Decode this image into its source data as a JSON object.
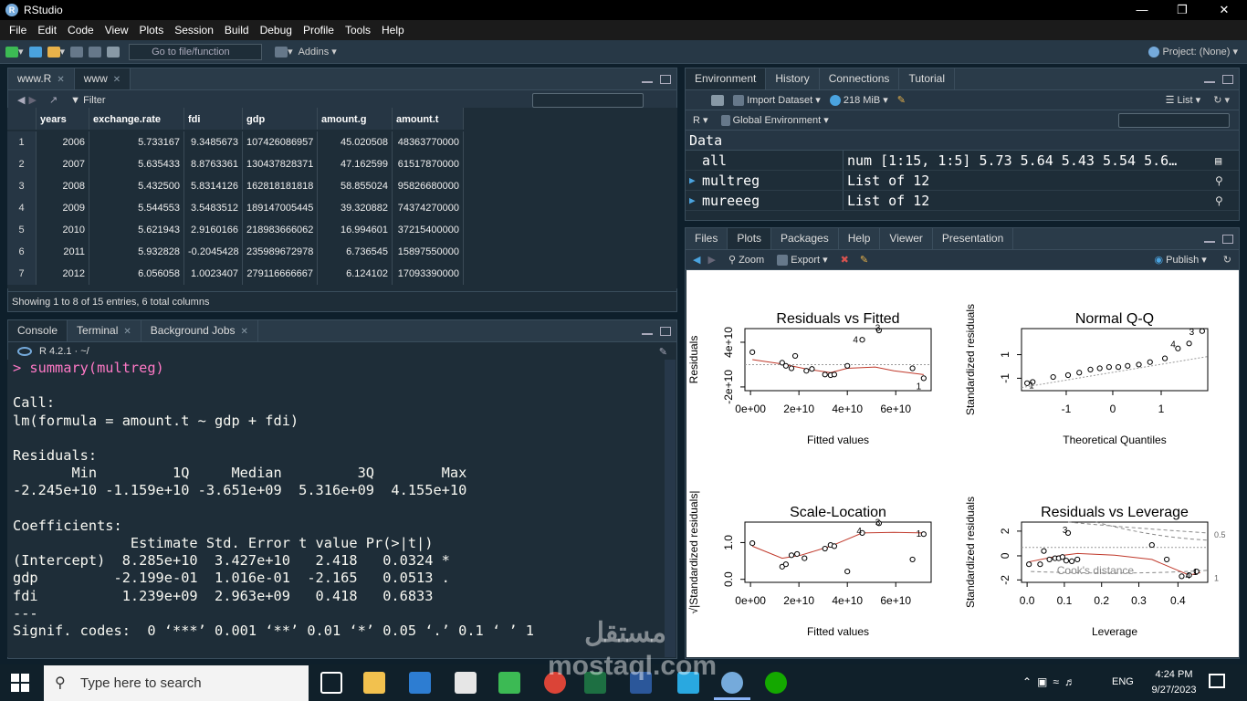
{
  "app": {
    "title": "RStudio",
    "logo_letter": "R"
  },
  "menu": [
    "File",
    "Edit",
    "Code",
    "View",
    "Plots",
    "Session",
    "Build",
    "Debug",
    "Profile",
    "Tools",
    "Help"
  ],
  "toolbar": {
    "goto_placeholder": "Go to file/function",
    "addins": "Addins",
    "project": "Project: (None)"
  },
  "source_tabs": [
    {
      "label": "www.R"
    },
    {
      "label": "www"
    }
  ],
  "data_viewer": {
    "filter_label": "Filter",
    "columns": [
      "years",
      "exchange.rate",
      "fdi",
      "gdp",
      "amount.g",
      "amount.t"
    ],
    "rows": [
      [
        "1",
        "2006",
        "5.733167",
        "9.3485673",
        "107426086957",
        "45.020508",
        "48363770000"
      ],
      [
        "2",
        "2007",
        "5.635433",
        "8.8763361",
        "130437828371",
        "47.162599",
        "61517870000"
      ],
      [
        "3",
        "2008",
        "5.432500",
        "5.8314126",
        "162818181818",
        "58.855024",
        "95826680000"
      ],
      [
        "4",
        "2009",
        "5.544553",
        "3.5483512",
        "189147005445",
        "39.320882",
        "74374270000"
      ],
      [
        "5",
        "2010",
        "5.621943",
        "2.9160166",
        "218983666062",
        "16.994601",
        "37215400000"
      ],
      [
        "6",
        "2011",
        "5.932828",
        "-0.2045428",
        "235989672978",
        "6.736545",
        "15897550000"
      ],
      [
        "7",
        "2012",
        "6.056058",
        "1.0023407",
        "279116666667",
        "6.124102",
        "17093390000"
      ]
    ],
    "status": "Showing 1 to 8 of 15 entries, 6 total columns"
  },
  "console": {
    "tabs": [
      "Console",
      "Terminal",
      "Background Jobs"
    ],
    "version": "R 4.2.1 · ~/",
    "command": "> summary(multreg)",
    "lines": [
      "",
      "Call:",
      "lm(formula = amount.t ~ gdp + fdi)",
      "",
      "Residuals:",
      "       Min         1Q     Median         3Q        Max ",
      "-2.245e+10 -1.159e+10 -3.651e+09  5.316e+09  4.155e+10 ",
      "",
      "Coefficients:",
      "              Estimate Std. Error t value Pr(>|t|)  ",
      "(Intercept)  8.285e+10  3.427e+10   2.418   0.0324 *",
      "gdp         -2.199e-01  1.016e-01  -2.165   0.0513 .",
      "fdi          1.239e+09  2.963e+09   0.418   0.6833  ",
      "---",
      "Signif. codes:  0 ‘***’ 0.001 ‘**’ 0.01 ‘*’ 0.05 ‘.’ 0.1 ‘ ’ 1"
    ]
  },
  "environment": {
    "tabs": [
      "Environment",
      "History",
      "Connections",
      "Tutorial"
    ],
    "import_dataset": "Import Dataset",
    "memory": "218 MiB",
    "list_label": "List",
    "lang": "R",
    "scope": "Global Environment",
    "section": "Data",
    "items": [
      {
        "name": "all",
        "value": "num [1:15, 1:5] 5.73 5.64 5.43 5.54 5.6…"
      },
      {
        "name": "multreg",
        "value": "List of  12"
      },
      {
        "name": "mureeeg",
        "value": "List of  12"
      }
    ]
  },
  "plots_pane": {
    "tabs": [
      "Files",
      "Plots",
      "Packages",
      "Help",
      "Viewer",
      "Presentation"
    ],
    "zoom": "Zoom",
    "export": "Export",
    "publish": "Publish"
  },
  "diagnostic_plots": {
    "p1": {
      "title": "Residuals vs Fitted",
      "xlabel": "Fitted values",
      "ylabel": "Residuals",
      "xticks": [
        "0e+00",
        "2e+10",
        "4e+10",
        "6e+10"
      ],
      "yticks": [
        "-2e+10",
        "4e+10"
      ],
      "labels": [
        "4",
        "3",
        "1"
      ]
    },
    "p2": {
      "title": "Normal Q-Q",
      "xlabel": "Theoretical Quantiles",
      "ylabel": "Standardized residuals",
      "xticks": [
        "-1",
        "0",
        "1"
      ],
      "yticks": [
        "-1",
        "1"
      ],
      "labels": [
        "4",
        "3",
        "1"
      ]
    },
    "p3": {
      "title": "Scale-Location",
      "xlabel": "Fitted values",
      "ylabel": "√|Standardized residuals|",
      "xticks": [
        "0e+00",
        "2e+10",
        "4e+10",
        "6e+10"
      ],
      "yticks": [
        "0.0",
        "1.0"
      ],
      "labels": [
        "4",
        "3",
        "1"
      ]
    },
    "p4": {
      "title": "Residuals vs Leverage",
      "xlabel": "Leverage",
      "ylabel": "Standardized residuals",
      "xticks": [
        "0.0",
        "0.1",
        "0.2",
        "0.3",
        "0.4"
      ],
      "yticks": [
        "-2",
        "0",
        "2"
      ],
      "cooks": "Cook's distance",
      "contours": [
        "0.5",
        "1"
      ],
      "labels": [
        "3",
        "4",
        "1"
      ]
    }
  },
  "taskbar": {
    "search_placeholder": "Type here to search",
    "lang": "ENG",
    "time": "4:24 PM",
    "date": "9/27/2023",
    "watermark": "مستقل mostaql.com"
  }
}
